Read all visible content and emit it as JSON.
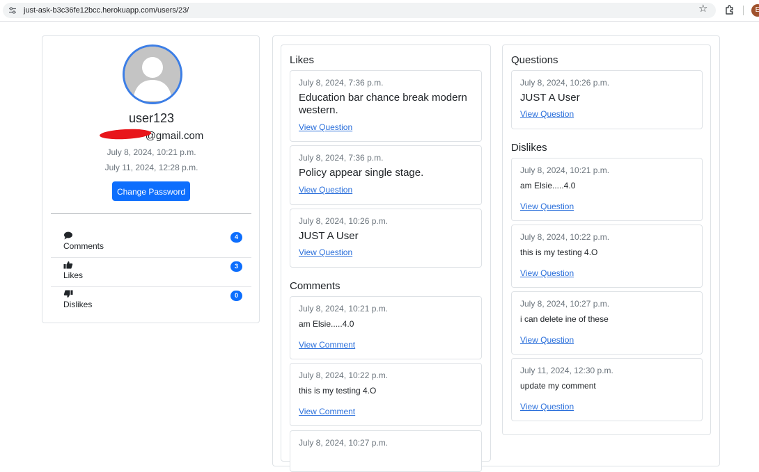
{
  "browser": {
    "url": "just-ask-b3c36fe12bcc.herokuapp.com/users/23/",
    "profile_initial": "E"
  },
  "profile": {
    "username": "user123",
    "email": "@gmail.com",
    "joined": "July 8, 2024, 10:21 p.m.",
    "last_login": "July 11, 2024, 12:28 p.m.",
    "change_password_label": "Change Password",
    "stats": [
      {
        "label": "Comments",
        "count": "4",
        "icon": "comment-icon"
      },
      {
        "label": "Likes",
        "count": "3",
        "icon": "thumbs-up-icon"
      },
      {
        "label": "Dislikes",
        "count": "0",
        "icon": "thumbs-down-icon"
      }
    ]
  },
  "likes": {
    "title": "Likes",
    "items": [
      {
        "date": "July 8, 2024, 7:36 p.m.",
        "title": "Education bar chance break modern western.",
        "link": "View Question"
      },
      {
        "date": "July 8, 2024, 7:36 p.m.",
        "title": "Policy appear single stage.",
        "link": "View Question"
      },
      {
        "date": "July 8, 2024, 10:26 p.m.",
        "title": "JUST A User",
        "link": "View Question"
      }
    ]
  },
  "comments": {
    "title": "Comments",
    "items": [
      {
        "date": "July 8, 2024, 10:21 p.m.",
        "text": "am Elsie.....4.0",
        "link": "View Comment"
      },
      {
        "date": "July 8, 2024, 10:22 p.m.",
        "text": "this is my testing 4.O",
        "link": "View Comment"
      },
      {
        "date": "July 8, 2024, 10:27 p.m.",
        "text": "",
        "link": ""
      }
    ]
  },
  "questions": {
    "title": "Questions",
    "items": [
      {
        "date": "July 8, 2024, 10:26 p.m.",
        "title": "JUST A User",
        "link": "View Question"
      }
    ]
  },
  "dislikes": {
    "title": "Dislikes",
    "items": [
      {
        "date": "July 8, 2024, 10:21 p.m.",
        "text": "am Elsie.....4.0",
        "link": "View Question"
      },
      {
        "date": "July 8, 2024, 10:22 p.m.",
        "text": "this is my testing 4.O",
        "link": "View Question"
      },
      {
        "date": "July 8, 2024, 10:27 p.m.",
        "text": "i can delete ine of these",
        "link": "View Question"
      },
      {
        "date": "July 11, 2024, 12:30 p.m.",
        "text": "update my comment",
        "link": "View Question"
      }
    ]
  },
  "colors": {
    "primary": "#0d6efd",
    "link": "#2a6fdb",
    "avatar_ring": "#3c7ee6",
    "redaction": "#e8161b"
  }
}
